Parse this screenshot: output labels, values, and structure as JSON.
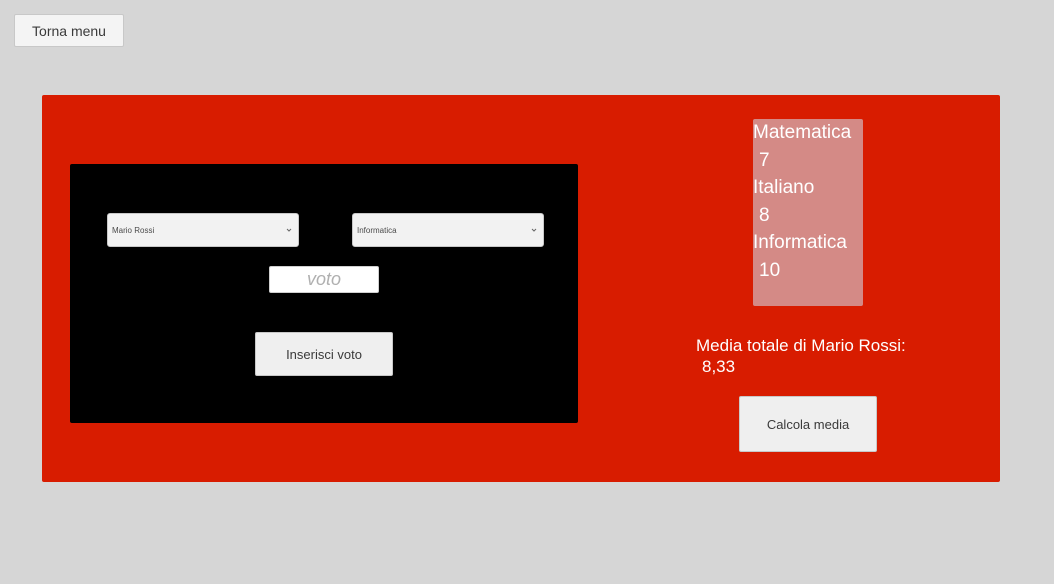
{
  "header": {
    "back_label": "Torna menu"
  },
  "form": {
    "student_selected": "Mario Rossi",
    "subject_selected": "Informatica",
    "vote_placeholder": "voto",
    "vote_value": "",
    "insert_label": "Inserisci voto"
  },
  "grades": [
    {
      "subject": "Matematica",
      "value": "7"
    },
    {
      "subject": "Italiano",
      "value": "8"
    },
    {
      "subject": "Informatica",
      "value": "10"
    }
  ],
  "average": {
    "label": "Media totale di Mario Rossi:",
    "value": "8,33",
    "calc_label": "Calcola media"
  },
  "colors": {
    "background": "#d6d6d6",
    "panel": "#d81c00",
    "form_box": "#000000",
    "grades_box": "#d48a86",
    "button": "#efefef"
  },
  "icons": {
    "dropdown": "chevron-down-icon"
  }
}
